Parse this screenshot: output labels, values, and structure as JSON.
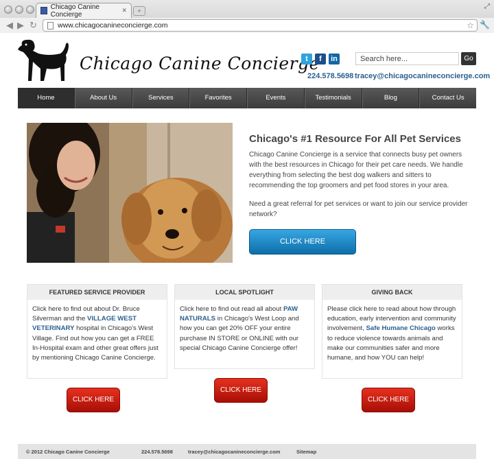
{
  "browser": {
    "tab_title": "Chicago Canine Concierge",
    "url": "www.chicagocanineconcierge.com"
  },
  "header": {
    "site_title": "Chicago Canine Concierge",
    "social": [
      "twitter-icon",
      "facebook-icon",
      "linkedin-icon"
    ],
    "search_placeholder": "Search here...",
    "search_button": "Go",
    "phone": "224.578.5698",
    "email": "tracey@chicagocanineconcierge.com"
  },
  "nav": {
    "items": [
      "Home",
      "About Us",
      "Services",
      "Favorites",
      "Events",
      "Testimonials",
      "Blog",
      "Contact Us"
    ],
    "active": "Home"
  },
  "hero": {
    "title": "Chicago's #1 Resource For All Pet Services",
    "body1": "Chicago Canine Concierge is a service that connects busy pet owners with the best resources in Chicago for their pet care needs. We handle everything from selecting the best dog walkers and sitters to recommending the top groomers and pet food stores in your area.",
    "body2": "Need a great referral for pet services or want to join our service provider network?",
    "cta": "CLICK HERE"
  },
  "boxes": [
    {
      "heading": "FEATURED SERVICE PROVIDER",
      "pre": "Click here to find out about Dr. Bruce Silverman and the ",
      "link": "VILLAGE WEST VETERINARY",
      "post": " hospital in Chicago's West Village. Find out how you can get a FREE In-Hospital exam and other great offers just by mentioning Chicago Canine Concierge.",
      "button": "CLICK HERE"
    },
    {
      "heading": "LOCAL SPOTLIGHT",
      "pre": "Click here to find out read all about ",
      "link": "PAW NATURALS",
      "post": "  in Chicago's West Loop and how you can get 20% OFF your entire purchase IN STORE or ONLINE with our special Chicago Canine Concierge offer!",
      "button": "CLICK HERE"
    },
    {
      "heading": "GIVING BACK",
      "pre": "Please click here to read about how through education, early intervention and community involvement, ",
      "link": "Safe Humane Chicago",
      "post": "  works to reduce violence towards animals and make our communities safer and more humane, and how YOU can help!",
      "button": "CLICK HERE"
    }
  ],
  "footer": {
    "copyright": "© 2012 Chicago Canine Concierge",
    "phone": "224.578.5698",
    "email": "tracey@chicagocanineconcierge.com",
    "sitemap": "Sitemap"
  },
  "colors": {
    "accent_blue": "#2b5f8e",
    "nav_bg": "#4a4a4a",
    "cta_blue": "#1f8bcb",
    "cta_red": "#cc1f12"
  }
}
